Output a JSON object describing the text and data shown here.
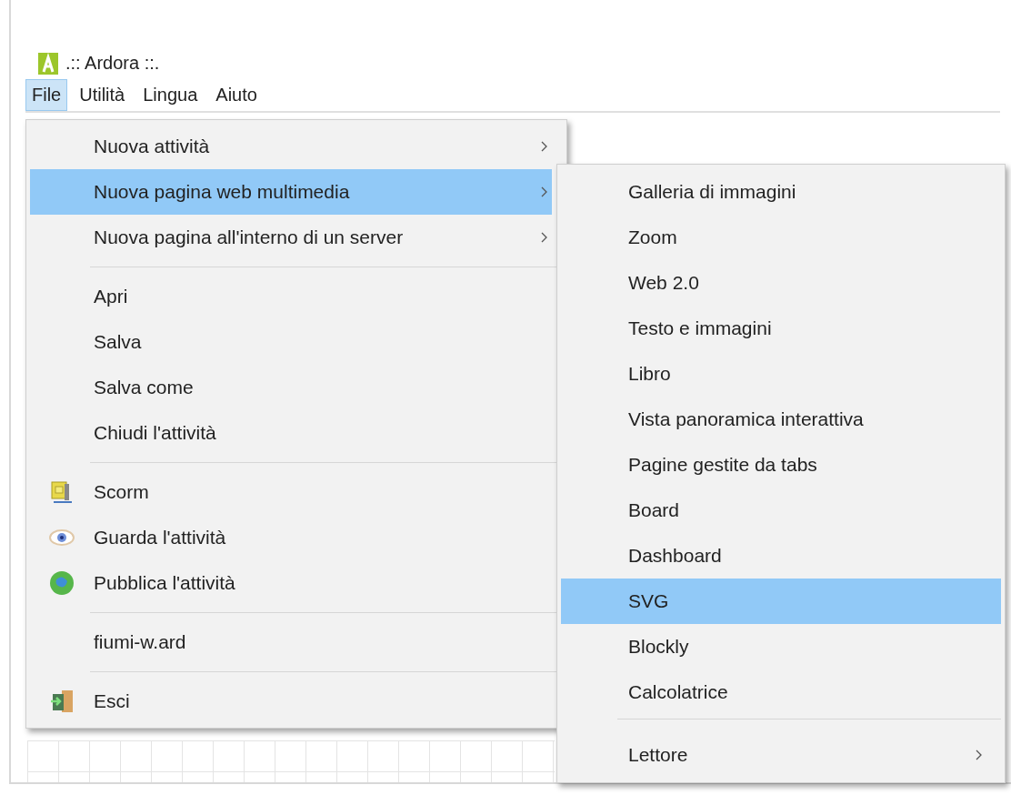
{
  "window": {
    "title": ".:: Ardora ::."
  },
  "menubar": [
    {
      "label": "File",
      "selected": true
    },
    {
      "label": "Utilità",
      "selected": false
    },
    {
      "label": "Lingua",
      "selected": false
    },
    {
      "label": "Aiuto",
      "selected": false
    }
  ],
  "file_menu": {
    "sections": [
      [
        {
          "label": "Nuova attività",
          "kind": "submenu",
          "selected": false
        },
        {
          "label": "Nuova pagina web multimedia",
          "kind": "submenu",
          "selected": true
        },
        {
          "label": "Nuova pagina all'interno di un server",
          "kind": "submenu",
          "selected": false
        }
      ],
      [
        {
          "label": "Apri",
          "kind": "command",
          "selected": false
        },
        {
          "label": "Salva",
          "kind": "command",
          "selected": false
        },
        {
          "label": "Salva come",
          "kind": "command",
          "selected": false
        },
        {
          "label": "Chiudi l'attività",
          "kind": "command",
          "selected": false
        }
      ],
      [
        {
          "label": "Scorm",
          "kind": "scorm",
          "selected": false
        },
        {
          "label": "Guarda l'attività",
          "kind": "preview",
          "selected": false
        },
        {
          "label": "Pubblica l'attività",
          "kind": "publish",
          "selected": false
        }
      ],
      [
        {
          "label": "fiumi-w.ard",
          "kind": "command",
          "selected": false
        }
      ],
      [
        {
          "label": "Esci",
          "kind": "exit",
          "selected": false
        }
      ]
    ]
  },
  "submenu": {
    "sections": [
      [
        {
          "label": "Galleria di immagini",
          "kind": "command",
          "selected": false
        },
        {
          "label": "Zoom",
          "kind": "command",
          "selected": false
        },
        {
          "label": "Web 2.0",
          "kind": "command",
          "selected": false
        },
        {
          "label": "Testo e immagini",
          "kind": "command",
          "selected": false
        },
        {
          "label": "Libro",
          "kind": "command",
          "selected": false
        },
        {
          "label": "Vista panoramica interattiva",
          "kind": "command",
          "selected": false
        },
        {
          "label": "Pagine gestite da tabs",
          "kind": "command",
          "selected": false
        },
        {
          "label": "Board",
          "kind": "command",
          "selected": false
        },
        {
          "label": "Dashboard",
          "kind": "command",
          "selected": false
        },
        {
          "label": "SVG",
          "kind": "command",
          "selected": true
        },
        {
          "label": "Blockly",
          "kind": "command",
          "selected": false
        },
        {
          "label": "Calcolatrice",
          "kind": "command",
          "selected": false
        }
      ],
      [
        {
          "label": "Lettore",
          "kind": "submenu",
          "selected": false
        }
      ]
    ]
  }
}
